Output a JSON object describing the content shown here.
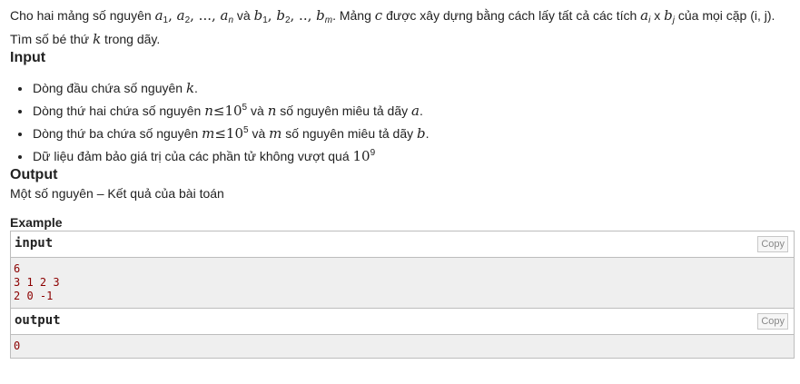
{
  "intro": {
    "t1": "Cho hai mảng số nguyên ",
    "a": "a",
    "s1": "1",
    "c1": ", ",
    "a2": "a",
    "s2": "2",
    "c2": ", ..., ",
    "an": "a",
    "sn": "n",
    "va": " và ",
    "b": "b",
    "bs1": "1",
    "c3": ", ",
    "b2": "b",
    "bs2": "2",
    "c4": ", .., ",
    "bm": "b",
    "bsm": "m",
    "dot": ". Mảng ",
    "c": "c",
    "t2": " được xây dựng bằng cách lấy tất cả các tích ",
    "ai": "a",
    "si": "i",
    "x": " x ",
    "bj": "b",
    "sj": "j",
    "t3": " của mọi cặp (i, j). Tìm số bé thứ ",
    "k": "k",
    "t4": " trong dãy."
  },
  "input_section": {
    "title": "Input",
    "items": [
      {
        "t1": "Dòng đầu chứa số nguyên ",
        "v": "k",
        "t2": "."
      },
      {
        "t1": "Dòng thứ hai chứa số nguyên ",
        "v": "n",
        "op": "≤",
        "base": "10",
        "exp": "5",
        "t2": " và ",
        "v2": "n",
        "t3": " số nguyên miêu tả dãy ",
        "v3": "a",
        "t4": "."
      },
      {
        "t1": "Dòng thứ ba chứa số nguyên ",
        "v": "m",
        "op": "≤",
        "base": "10",
        "exp": "5",
        "t2": " và ",
        "v2": "m",
        "t3": " số nguyên miêu tả dãy ",
        "v3": "b",
        "t4": "."
      },
      {
        "t1": "Dữ liệu đảm bảo giá trị của các phần tử không vượt quá ",
        "base": "10",
        "exp": "9"
      }
    ]
  },
  "output_section": {
    "title": "Output",
    "desc": "Một số nguyên – Kết quả của bài toán"
  },
  "example": {
    "title": "Example",
    "input_label": "input",
    "output_label": "output",
    "copy_label": "Copy",
    "input_lines": [
      "6",
      "3 1 2 3",
      "2 0 -1"
    ],
    "output_lines": [
      "0"
    ]
  }
}
